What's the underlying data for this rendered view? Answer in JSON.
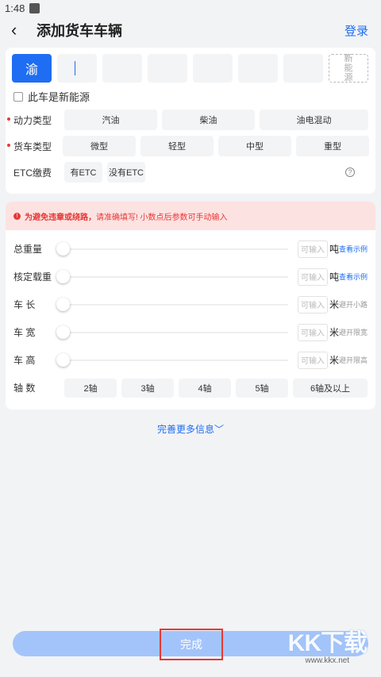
{
  "status": {
    "time": "1:48"
  },
  "header": {
    "title": "添加货车车辆",
    "login": "登录"
  },
  "plate": {
    "province": "渝",
    "new_energy_label": [
      "新",
      "能",
      "源"
    ]
  },
  "new_energy_check": {
    "label": "此车是新能源"
  },
  "power": {
    "label": "动力类型",
    "options": [
      "汽油",
      "柴油",
      "油电混动"
    ]
  },
  "truck_type": {
    "label": "货车类型",
    "options": [
      "微型",
      "轻型",
      "中型",
      "重型"
    ]
  },
  "etc": {
    "label": "ETC缴费",
    "options": [
      "有ETC",
      "没有ETC"
    ]
  },
  "warning": {
    "bold": "为避免违章或绕路，",
    "text": "请准确填写! 小数点后参数可手动输入"
  },
  "sliders": [
    {
      "label": "总重量",
      "placeholder": "可输入",
      "unit": "吨",
      "extra": "查看示例",
      "extra_type": "link"
    },
    {
      "label": "核定载重",
      "placeholder": "可输入",
      "unit": "吨",
      "extra": "查看示例",
      "extra_type": "link"
    },
    {
      "label": "车 长",
      "placeholder": "可输入",
      "unit": "米",
      "extra": "避开小路",
      "extra_type": "hint"
    },
    {
      "label": "车 宽",
      "placeholder": "可输入",
      "unit": "米",
      "extra": "避开限宽",
      "extra_type": "hint"
    },
    {
      "label": "车 高",
      "placeholder": "可输入",
      "unit": "米",
      "extra": "避开限高",
      "extra_type": "hint"
    }
  ],
  "axles": {
    "label": "轴 数",
    "options": [
      "2轴",
      "3轴",
      "4轴",
      "5轴",
      "6轴及以上"
    ]
  },
  "more": {
    "label": "完善更多信息﹀"
  },
  "done": {
    "label": "完成"
  },
  "watermark": {
    "big": "KK下载",
    "small": "www.kkx.net"
  }
}
